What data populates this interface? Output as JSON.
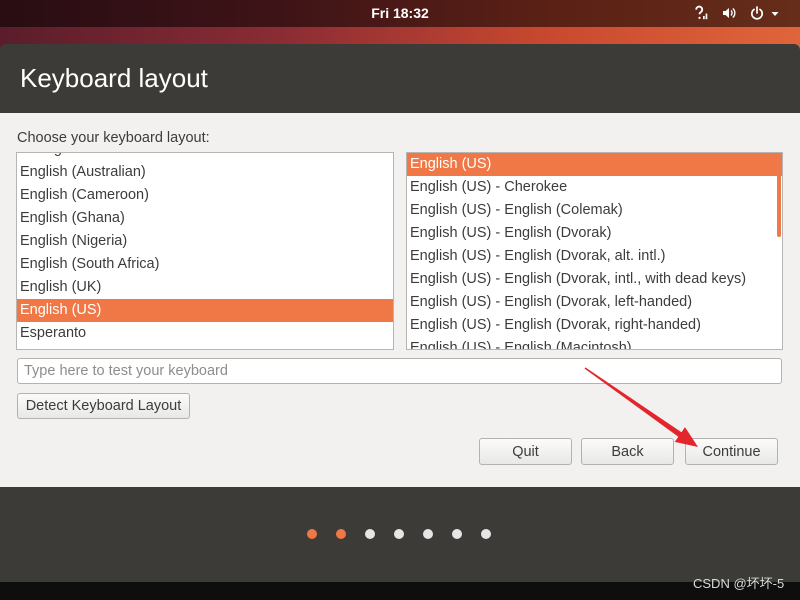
{
  "top_bar": {
    "clock": "Fri 18:32",
    "icons": [
      "network-offline-icon",
      "volume-icon",
      "power-icon",
      "chevron-down-icon"
    ]
  },
  "installer": {
    "title": "Keyboard layout",
    "prompt": "Choose your keyboard layout:",
    "layouts": {
      "items": [
        "Dzongkha",
        "English (Australian)",
        "English (Cameroon)",
        "English (Ghana)",
        "English (Nigeria)",
        "English (South Africa)",
        "English (UK)",
        "English (US)",
        "Esperanto"
      ],
      "selected_index": 7
    },
    "variants": {
      "items": [
        "English (US)",
        "English (US) - Cherokee",
        "English (US) - English (Colemak)",
        "English (US) - English (Dvorak)",
        "English (US) - English (Dvorak, alt. intl.)",
        "English (US) - English (Dvorak, intl., with dead keys)",
        "English (US) - English (Dvorak, left-handed)",
        "English (US) - English (Dvorak, right-handed)",
        "English (US) - English (Macintosh)"
      ],
      "selected_index": 0
    },
    "test_input": {
      "value": "",
      "placeholder": "Type here to test your keyboard"
    },
    "detect_button": "Detect Keyboard Layout",
    "buttons": {
      "quit": "Quit",
      "back": "Back",
      "continue": "Continue"
    }
  },
  "progress": {
    "total_steps": 7,
    "highlighted_steps": 2
  },
  "colors": {
    "accent": "#f07746",
    "chrome": "#3c3b37",
    "content_bg": "#f2f1f0",
    "annotation": "#e3262c"
  },
  "watermark": "CSDN @坏坏-5"
}
